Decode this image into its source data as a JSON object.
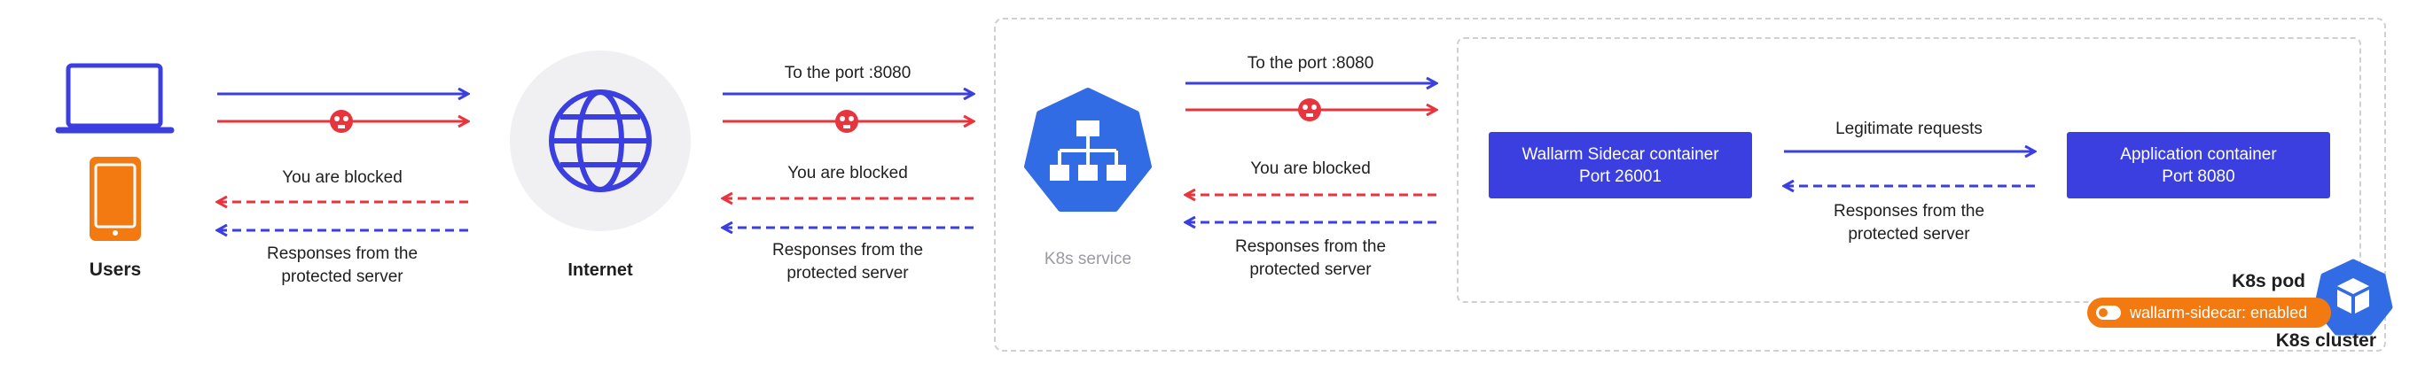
{
  "nodes": {
    "users": "Users",
    "internet": "Internet",
    "k8s_service": "K8s service",
    "sidecar": [
      "Wallarm Sidecar container",
      "Port 26001"
    ],
    "app": [
      "Application container",
      "Port 8080"
    ],
    "k8s_pod": "K8s pod",
    "k8s_cluster": "K8s cluster"
  },
  "labels": {
    "to_port_1": "To the port :8080",
    "to_port_2": "To the port :8080",
    "blocked_1": "You are blocked",
    "blocked_2": "You are blocked",
    "blocked_3": "You are blocked",
    "resp_1": [
      "Responses from the",
      "protected server"
    ],
    "resp_2": [
      "Responses from the",
      "protected server"
    ],
    "resp_3": [
      "Responses from the",
      "protected server"
    ],
    "resp_4": [
      "Responses from the",
      "protected server"
    ],
    "legit": "Legitimate requests"
  },
  "badge": {
    "text": "wallarm-sidecar: enabled"
  },
  "colors": {
    "blue": "#3b3fe0",
    "red": "#e8343c",
    "orange": "#f37a10",
    "k8s_blue": "#326ce5"
  }
}
